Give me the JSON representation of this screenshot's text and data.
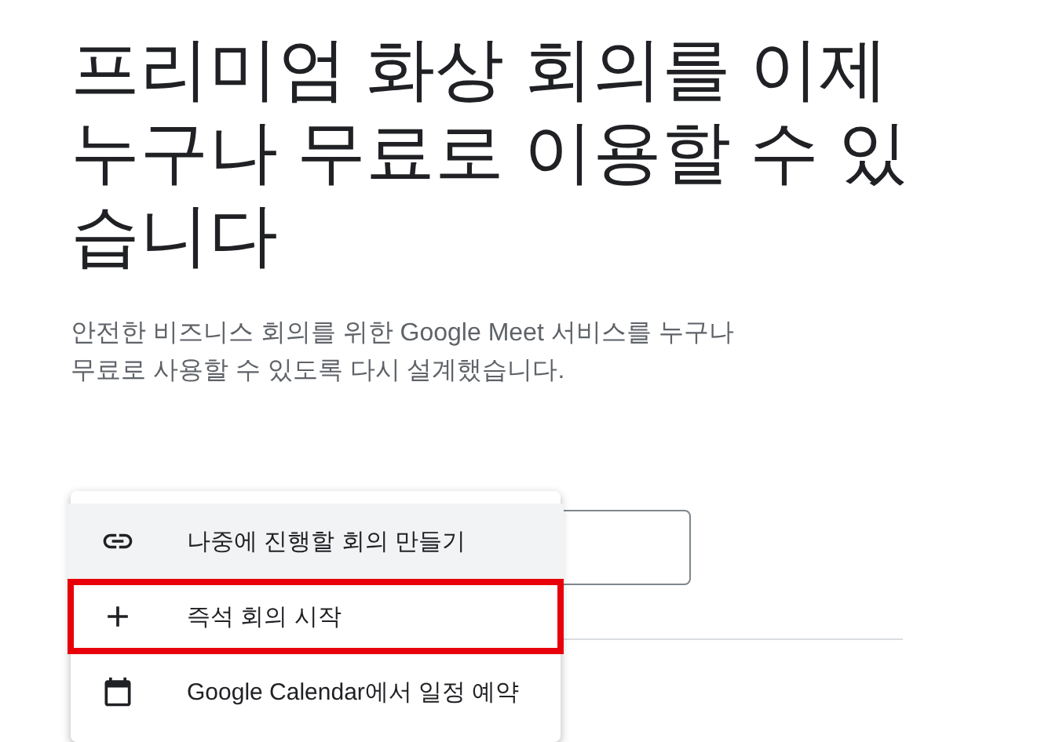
{
  "heading_lines": [
    "프리미엄 화상 회의를 이제",
    "누구나 무료로 이용할 수 있",
    "습니다"
  ],
  "subtitle_lines": [
    "안전한 비즈니스 회의를 위한 Google Meet 서비스를 누구나",
    "무료로 사용할 수 있도록 다시 설계했습니다."
  ],
  "menu": {
    "items": [
      {
        "kind": "link",
        "label": "나중에 진행할 회의 만들기",
        "selected": true,
        "marked": false
      },
      {
        "kind": "plus",
        "label": "즉석 회의 시작",
        "selected": false,
        "marked": true
      },
      {
        "kind": "calendar",
        "label": "Google Calendar에서 일정 예약",
        "selected": false,
        "marked": false
      }
    ]
  }
}
